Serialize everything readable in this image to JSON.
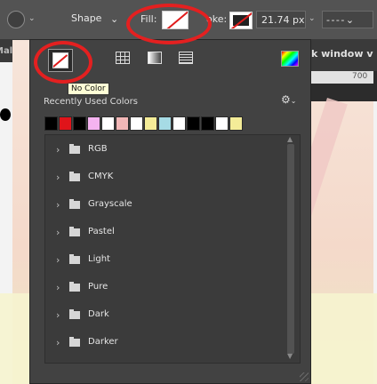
{
  "optionsbar": {
    "shape_mode": "Shape",
    "fill_label": "Fill:",
    "stroke_label": "oke:",
    "stroke_width": "21.74 px"
  },
  "document": {
    "left_tab_fragment": "Mal",
    "right_tab_fragment": "k window v",
    "ruler_number": "700"
  },
  "panel": {
    "tooltip": "No Color",
    "recent_label": "Recently Used Colors",
    "recent_colors": [
      "#000000",
      "#e0141a",
      "#000000",
      "#f5b3f0",
      "#ffffff",
      "#f2b7b7",
      "#ffffff",
      "#f4ec98",
      "#a6dbe5",
      "#ffffff",
      "#000000",
      "#000000",
      "#ffffff",
      "#f4ec98"
    ],
    "groups": [
      "RGB",
      "CMYK",
      "Grayscale",
      "Pastel",
      "Light",
      "Pure",
      "Dark",
      "Darker"
    ]
  },
  "colors": {
    "annotation_red": "#e42020",
    "panel_bg": "#424242"
  }
}
